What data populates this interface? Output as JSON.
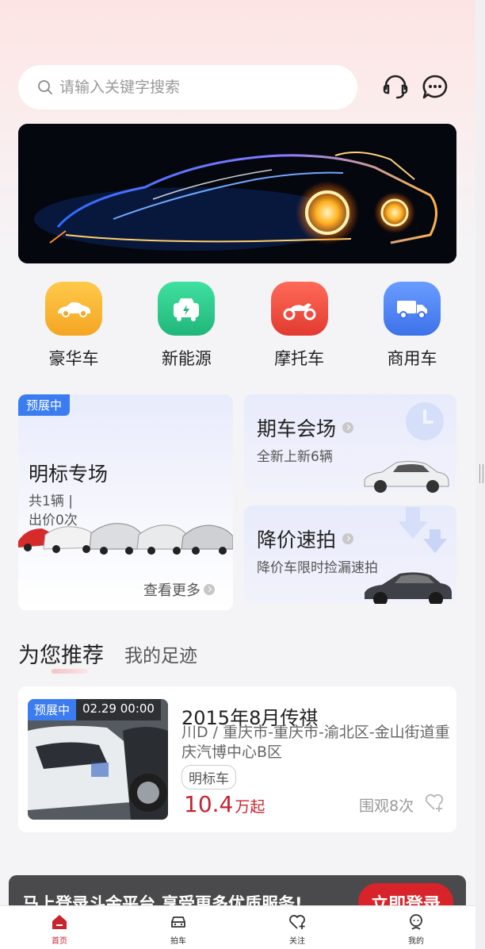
{
  "search": {
    "placeholder": "请输入关键字搜索"
  },
  "header_icons": [
    "headset-icon",
    "chat-icon"
  ],
  "categories": [
    {
      "label": "豪华车",
      "icon": "sports-car-icon",
      "color": "#f7b835"
    },
    {
      "label": "新能源",
      "icon": "ev-charging-icon",
      "color": "#2fcc8c"
    },
    {
      "label": "摩托车",
      "icon": "motorcycle-icon",
      "color": "#ee4b3f"
    },
    {
      "label": "商用车",
      "icon": "truck-icon",
      "color": "#4e86f2"
    }
  ],
  "promo": {
    "big": {
      "badge": "预展中",
      "title": "明标专场",
      "sub_line1": "共1辆 |",
      "sub_line2": "出价0次",
      "more": "查看更多"
    },
    "cards": [
      {
        "title": "期车会场",
        "subtitle": "全新上新6辆"
      },
      {
        "title": "降价速拍",
        "subtitle": "降价车限时捡漏速拍"
      }
    ]
  },
  "tabs": {
    "active": "为您推荐",
    "other": "我的足迹"
  },
  "recommendation": {
    "badge": "预展中",
    "time": "02.29 00:00",
    "title": "2015年8月传祺",
    "location": "川D / 重庆市-重庆市-渝北区-金山街道重庆汽博中心B区",
    "tag": "明标车",
    "price": "10.4",
    "price_unit": "万起",
    "views": "围观8次"
  },
  "login_bar": {
    "text": "马上登录斗金平台,享受更多优质服务!",
    "button": "立即登录"
  },
  "tabbar": [
    {
      "label": "首页",
      "icon": "home-icon",
      "active": true
    },
    {
      "label": "拍车",
      "icon": "car-icon",
      "active": false
    },
    {
      "label": "关注",
      "icon": "heart-plus-icon",
      "active": false
    },
    {
      "label": "我的",
      "icon": "user-icon",
      "active": false
    }
  ],
  "colors": {
    "accent_red": "#c7242e",
    "badge_blue": "#3b7cf0"
  }
}
